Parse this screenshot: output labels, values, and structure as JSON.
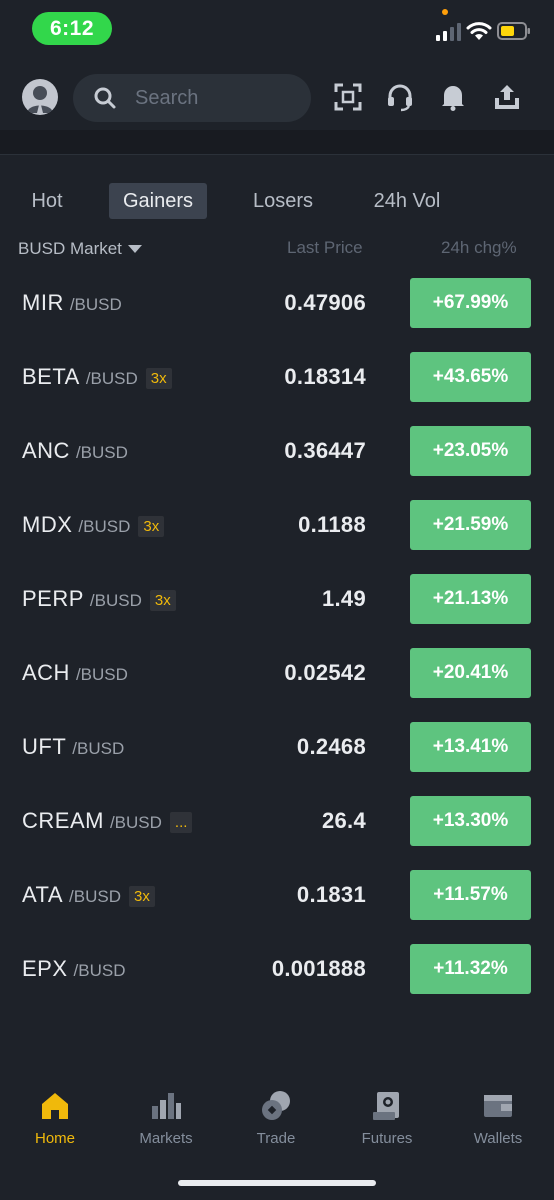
{
  "status_bar": {
    "time": "6:12"
  },
  "header": {
    "search_placeholder": "Search",
    "icons": [
      "avatar-icon",
      "scan-icon",
      "headset-icon",
      "bell-icon",
      "upload-icon"
    ]
  },
  "tabs": [
    {
      "label": "Hot",
      "active": false
    },
    {
      "label": "Gainers",
      "active": true
    },
    {
      "label": "Losers",
      "active": false
    },
    {
      "label": "24h Vol",
      "active": false
    }
  ],
  "columns": {
    "market": "BUSD Market",
    "last_price": "Last Price",
    "change": "24h chg%"
  },
  "rows": [
    {
      "base": "MIR",
      "quote": "/BUSD",
      "badge": "",
      "price": "0.47906",
      "change": "+67.99%"
    },
    {
      "base": "BETA",
      "quote": "/BUSD",
      "badge": "3x",
      "price": "0.18314",
      "change": "+43.65%"
    },
    {
      "base": "ANC",
      "quote": "/BUSD",
      "badge": "",
      "price": "0.36447",
      "change": "+23.05%"
    },
    {
      "base": "MDX",
      "quote": "/BUSD",
      "badge": "3x",
      "price": "0.1188",
      "change": "+21.59%"
    },
    {
      "base": "PERP",
      "quote": "/BUSD",
      "badge": "3x",
      "price": "1.49",
      "change": "+21.13%"
    },
    {
      "base": "ACH",
      "quote": "/BUSD",
      "badge": "",
      "price": "0.02542",
      "change": "+20.41%"
    },
    {
      "base": "UFT",
      "quote": "/BUSD",
      "badge": "",
      "price": "0.2468",
      "change": "+13.41%"
    },
    {
      "base": "CREAM",
      "quote": "/BUSD",
      "badge": "...",
      "price": "26.4",
      "change": "+13.30%"
    },
    {
      "base": "ATA",
      "quote": "/BUSD",
      "badge": "3x",
      "price": "0.1831",
      "change": "+11.57%"
    },
    {
      "base": "EPX",
      "quote": "/BUSD",
      "badge": "",
      "price": "0.001888",
      "change": "+11.32%"
    }
  ],
  "nav": [
    {
      "label": "Home",
      "icon": "home-icon",
      "active": true
    },
    {
      "label": "Markets",
      "icon": "markets-icon",
      "active": false
    },
    {
      "label": "Trade",
      "icon": "trade-icon",
      "active": false
    },
    {
      "label": "Futures",
      "icon": "futures-icon",
      "active": false
    },
    {
      "label": "Wallets",
      "icon": "wallet-icon",
      "active": false
    }
  ],
  "colors": {
    "accent": "#f0b90b",
    "gain": "#5ec47f",
    "background": "#1e2229"
  }
}
